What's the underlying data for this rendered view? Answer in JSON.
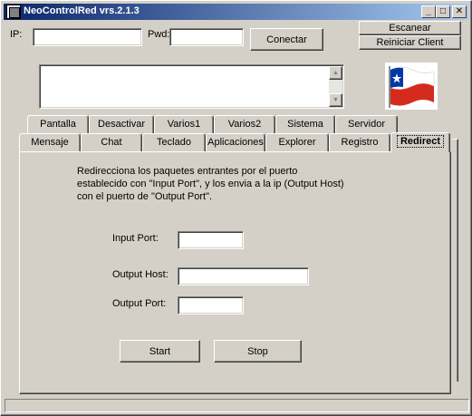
{
  "window": {
    "title": "NeoControlRed vrs.2.1.3",
    "min_glyph": "_",
    "max_glyph": "□",
    "close_glyph": "✕"
  },
  "connection": {
    "ip_label": "IP:",
    "ip_value": "",
    "pwd_label": "Pwd:",
    "pwd_value": "",
    "connect_label": "Conectar",
    "scan_label": "Escanear",
    "restart_label": "Reiniciar Client"
  },
  "log": {
    "text": "",
    "scroll_up": "▲",
    "scroll_down": "▼"
  },
  "tabs_row_back": [
    "Pantalla",
    "Desactivar",
    "Varios1",
    "Varios2",
    "Sistema",
    "Servidor"
  ],
  "tabs_row_front": [
    "Mensaje",
    "Chat",
    "Teclado",
    "Aplicaciones",
    "Explorer",
    "Registro",
    "Redirect"
  ],
  "redirect": {
    "description_1": "Redirecciona los paquetes entrantes por el puerto",
    "description_2": "establecido con \"Input Port\", y los envia a la ip (Output Host)",
    "description_3": "con el puerto de \"Output Port\".",
    "input_port_label": "Input Port:",
    "input_port_value": "",
    "output_host_label": "Output Host:",
    "output_host_value": "",
    "output_port_label": "Output Port:",
    "output_port_value": "",
    "start_label": "Start",
    "stop_label": "Stop"
  },
  "flag": {
    "icon": "chile-flag-icon"
  },
  "colors": {
    "titlebar_start": "#0a246a",
    "titlebar_end": "#a6caf0",
    "face": "#d4d0c8",
    "flag_red": "#d52b1e",
    "flag_blue": "#0039a6"
  }
}
